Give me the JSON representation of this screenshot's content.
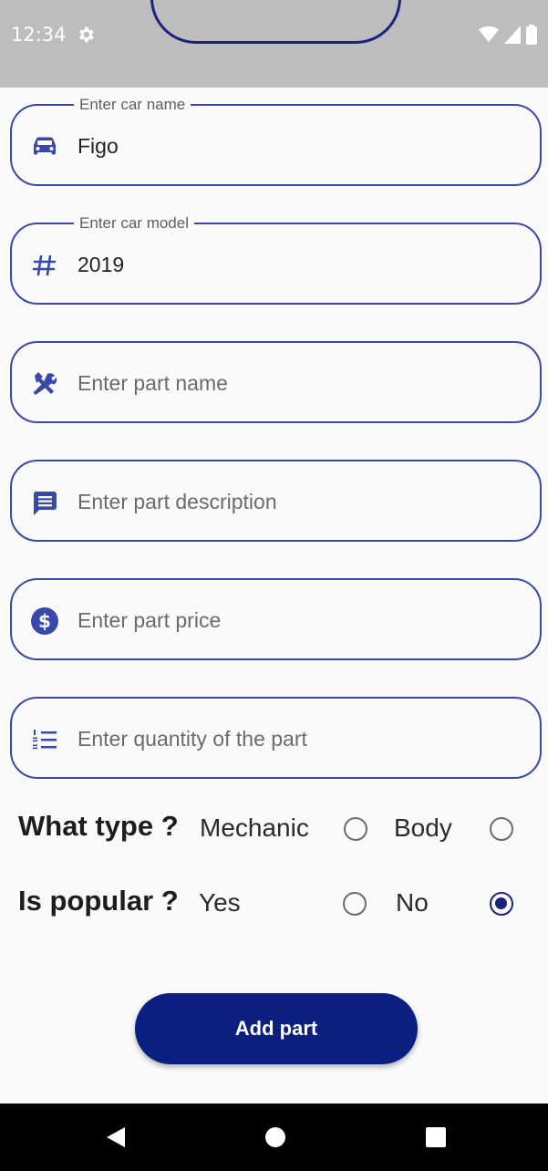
{
  "status_bar": {
    "time": "12:34",
    "icons": [
      "gear-icon",
      "wifi-icon",
      "signal-icon",
      "battery-icon"
    ]
  },
  "fields": {
    "car_name": {
      "label": "Enter car name",
      "value": "Figo",
      "icon": "car-icon"
    },
    "car_model": {
      "label": "Enter car model",
      "value": "2019",
      "icon": "hash-icon"
    },
    "part_name": {
      "placeholder": "Enter part name",
      "icon": "tools-icon"
    },
    "part_description": {
      "placeholder": "Enter part description",
      "icon": "message-icon"
    },
    "part_price": {
      "placeholder": "Enter part price",
      "icon": "dollar-icon"
    },
    "part_quantity": {
      "placeholder": "Enter quantity of the part",
      "icon": "numbered-list-icon"
    }
  },
  "type_question": {
    "label": "What type ?",
    "options": [
      {
        "label": "Mechanic",
        "selected": false
      },
      {
        "label": "Body",
        "selected": false
      }
    ]
  },
  "popular_question": {
    "label": "Is popular ?",
    "options": [
      {
        "label": "Yes",
        "selected": false
      },
      {
        "label": "No",
        "selected": true
      }
    ]
  },
  "add_button": {
    "label": "Add part"
  },
  "nav_bar": {
    "icons": [
      "back-icon",
      "home-icon",
      "recents-icon"
    ]
  },
  "colors": {
    "accent": "#3949ab",
    "primary_dark": "#0b1f80",
    "status_bar_bg": "#bdbdbd"
  }
}
